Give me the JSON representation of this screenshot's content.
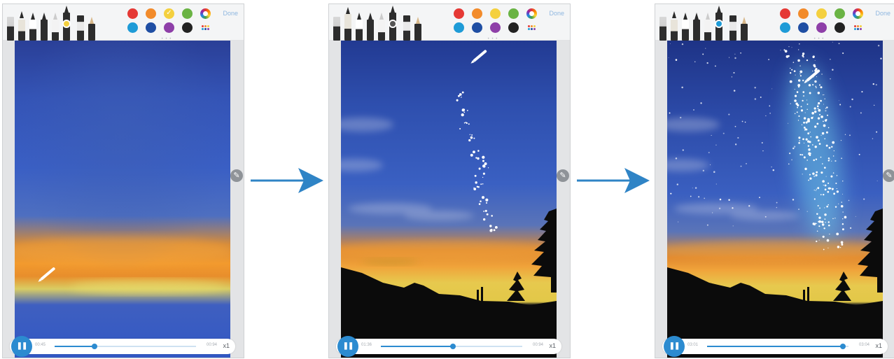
{
  "toolbar": {
    "done_label": "Done",
    "page_indicator": "• • • •"
  },
  "colors": {
    "swatches": [
      "#e53935",
      "#f28b2b",
      "#f4d03f",
      "#6ab344",
      "rainbow",
      "#1e9bd7",
      "#1f4ea3",
      "#8e3fa8",
      "#222222",
      "more"
    ],
    "accent": "#2c8bd0"
  },
  "frames": [
    {
      "selected_pen_color": "#f4d03f",
      "palette_checked": "#f4d03f",
      "playback": {
        "current_time": "00:45",
        "total_time": "00:94",
        "progress": 0.28,
        "speed": "x1"
      }
    },
    {
      "selected_pen_color": "#555555",
      "palette_checked": "",
      "playback": {
        "current_time": "01:36",
        "total_time": "00:94",
        "progress": 0.51,
        "speed": "x1"
      }
    },
    {
      "selected_pen_color": "#1e9bd7",
      "palette_checked": "",
      "playback": {
        "current_time": "03:01",
        "total_time": "03:04",
        "progress": 0.96,
        "speed": "x1"
      }
    }
  ],
  "icons": {
    "play": "pause-icon",
    "edit": "pencil-icon",
    "arrow": "right-arrow-icon"
  }
}
